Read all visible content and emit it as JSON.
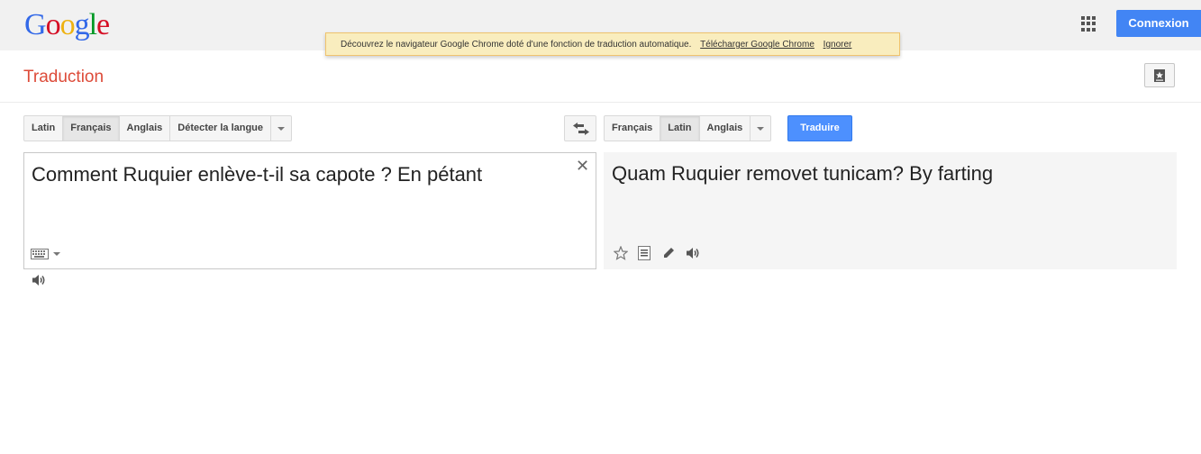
{
  "header": {
    "logo_letters": [
      "G",
      "o",
      "o",
      "g",
      "l",
      "e"
    ],
    "signin_label": "Connexion"
  },
  "promo": {
    "message": "Découvrez le navigateur Google Chrome doté d'une fonction de traduction automatique.",
    "download_link": "Télécharger Google Chrome",
    "ignore_link": "Ignorer"
  },
  "page": {
    "title": "Traduction"
  },
  "source_langs": [
    "Latin",
    "Français",
    "Anglais",
    "Détecter la langue"
  ],
  "source_active": "Français",
  "target_langs": [
    "Français",
    "Latin",
    "Anglais"
  ],
  "target_active": "Latin",
  "translate_label": "Traduire",
  "source": {
    "text": "Comment Ruquier enlève-t-il sa capote ? En pétant",
    "clear_glyph": "✕"
  },
  "result": {
    "text": "Quam Ruquier removet tunicam? By farting"
  },
  "icons": {
    "apps": "apps-grid-icon",
    "bookmark": "phrasebook-icon",
    "swap": "swap-languages-icon",
    "keyboard": "keyboard-icon",
    "listen": "speaker-icon",
    "star": "star-icon",
    "alternatives": "list-icon",
    "edit": "pencil-icon"
  },
  "colors": {
    "accent_blue": "#4285f4",
    "title_red": "#dd4b39",
    "promo_bg": "#f9edbe"
  }
}
